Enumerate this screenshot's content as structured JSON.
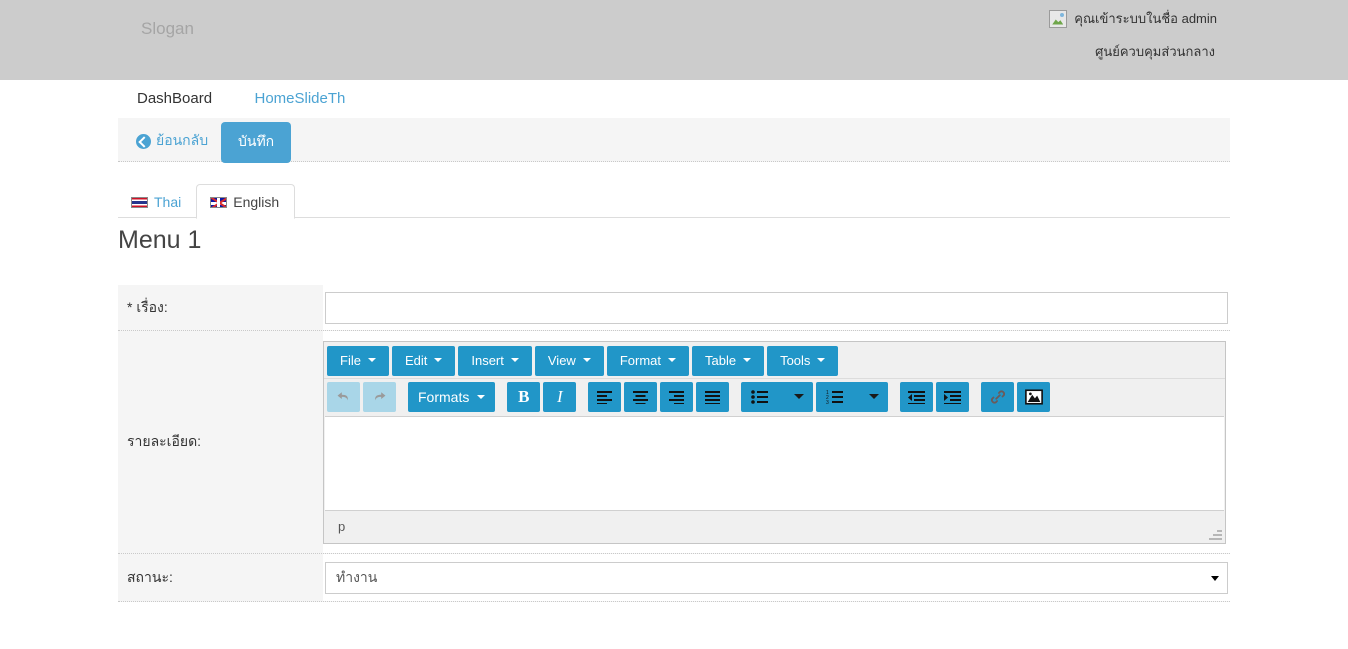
{
  "header": {
    "slogan": "Slogan",
    "user_icon": "broken-image-icon",
    "user_greeting": "คุณเข้าระบบในชื่อ admin",
    "org_name": "ศูนย์ควบคุมส่วนกลาง"
  },
  "nav_tabs": [
    {
      "label": "DashBoard",
      "active": false
    },
    {
      "label": "HomeSlideTh",
      "active": true
    }
  ],
  "action_bar": {
    "back_label": "ย้อนกลับ",
    "back_icon": "arrow-left-circle-icon",
    "save_label": "บันทึก"
  },
  "lang_tabs": [
    {
      "label": "Thai",
      "flag": "thailand-flag-icon",
      "active": false
    },
    {
      "label": "English",
      "flag": "united-kingdom-flag-icon",
      "active": true
    }
  ],
  "page_heading": "Menu 1",
  "form": {
    "subject": {
      "label": "* เรื่อง:",
      "value": "",
      "placeholder": ""
    },
    "detail": {
      "label": "รายละเอียด:"
    },
    "status": {
      "label": "สถานะ:",
      "value": "ทำงาน",
      "caret_icon": "chevron-down-icon"
    }
  },
  "editor": {
    "menubar": [
      {
        "label": "File",
        "caret": "caret-down-icon"
      },
      {
        "label": "Edit",
        "caret": "caret-down-icon"
      },
      {
        "label": "Insert",
        "caret": "caret-down-icon"
      },
      {
        "label": "View",
        "caret": "caret-down-icon"
      },
      {
        "label": "Format",
        "caret": "caret-down-icon"
      },
      {
        "label": "Table",
        "caret": "caret-down-icon"
      },
      {
        "label": "Tools",
        "caret": "caret-down-icon"
      }
    ],
    "toolbar": {
      "undo": {
        "icon": "undo-icon",
        "label": "",
        "disabled": true
      },
      "redo": {
        "icon": "redo-icon",
        "label": "",
        "disabled": true
      },
      "formats": {
        "label": "Formats",
        "icon": "caret-down-icon"
      },
      "bold": {
        "label": "B",
        "icon": "bold-icon"
      },
      "italic": {
        "label": "I",
        "icon": "italic-icon"
      },
      "align_left": {
        "icon": "align-left-icon"
      },
      "align_center": {
        "icon": "align-center-icon"
      },
      "align_right": {
        "icon": "align-right-icon"
      },
      "align_justify": {
        "icon": "align-justify-icon"
      },
      "bullist": {
        "icon": "bullet-list-icon"
      },
      "numlist": {
        "icon": "numbered-list-icon"
      },
      "outdent": {
        "icon": "outdent-icon"
      },
      "indent": {
        "icon": "indent-icon"
      },
      "link": {
        "icon": "link-icon"
      },
      "image": {
        "icon": "image-icon"
      }
    },
    "content": "",
    "statusbar_path": "p",
    "resize_handle": "resize-grip-icon"
  },
  "colors": {
    "accent_blue": "#4ba3d3",
    "editor_blue": "#2196c8",
    "editor_blue_disabled": "#a9d6e8",
    "header_gray": "#cccccc",
    "row_gray": "#f5f5f5"
  }
}
